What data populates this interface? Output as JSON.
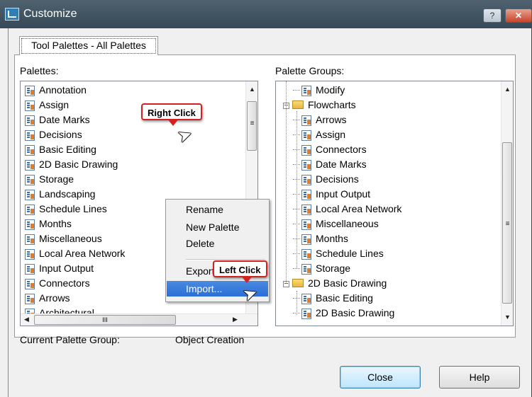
{
  "window": {
    "title": "Customize"
  },
  "titlebar": {
    "help_label": "?",
    "close_label": "✕"
  },
  "tab": {
    "label": "Tool Palettes - All Palettes"
  },
  "palettes": {
    "label": "Palettes:",
    "items": [
      "Annotation",
      "Assign",
      "Date Marks",
      "Decisions",
      "Basic Editing",
      "2D Basic Drawing",
      "Storage",
      "Landscaping",
      "Schedule Lines",
      "Months",
      "Miscellaneous",
      "Local Area Network",
      "Input Output",
      "Connectors",
      "Arrows",
      "Architectural"
    ],
    "hscroll_label": "III"
  },
  "palette_groups": {
    "label": "Palette Groups:",
    "items": [
      {
        "text": "Modify",
        "type": "palette"
      },
      {
        "text": "Flowcharts",
        "type": "folder"
      },
      {
        "text": "Arrows",
        "type": "palette"
      },
      {
        "text": "Assign",
        "type": "palette"
      },
      {
        "text": "Connectors",
        "type": "palette"
      },
      {
        "text": "Date Marks",
        "type": "palette"
      },
      {
        "text": "Decisions",
        "type": "palette"
      },
      {
        "text": "Input Output",
        "type": "palette"
      },
      {
        "text": "Local Area Network",
        "type": "palette"
      },
      {
        "text": "Miscellaneous",
        "type": "palette"
      },
      {
        "text": "Months",
        "type": "palette"
      },
      {
        "text": "Schedule Lines",
        "type": "palette"
      },
      {
        "text": "Storage",
        "type": "palette"
      },
      {
        "text": "2D Basic Drawing",
        "type": "folder"
      },
      {
        "text": "Basic Editing",
        "type": "palette"
      },
      {
        "text": "2D Basic Drawing",
        "type": "palette"
      }
    ]
  },
  "context_menu": {
    "items": [
      "Rename",
      "New Palette",
      "Delete",
      "Export...",
      "Import..."
    ],
    "highlighted": "Import..."
  },
  "callouts": {
    "right_click": "Right Click",
    "left_click": "Left Click"
  },
  "footer": {
    "current_group_label": "Current Palette Group:",
    "current_group_value": "Object Creation"
  },
  "buttons": {
    "close": "Close",
    "help": "Help"
  },
  "colors": {
    "callout_border": "#d32020",
    "highlight": "#2b6fd6"
  }
}
